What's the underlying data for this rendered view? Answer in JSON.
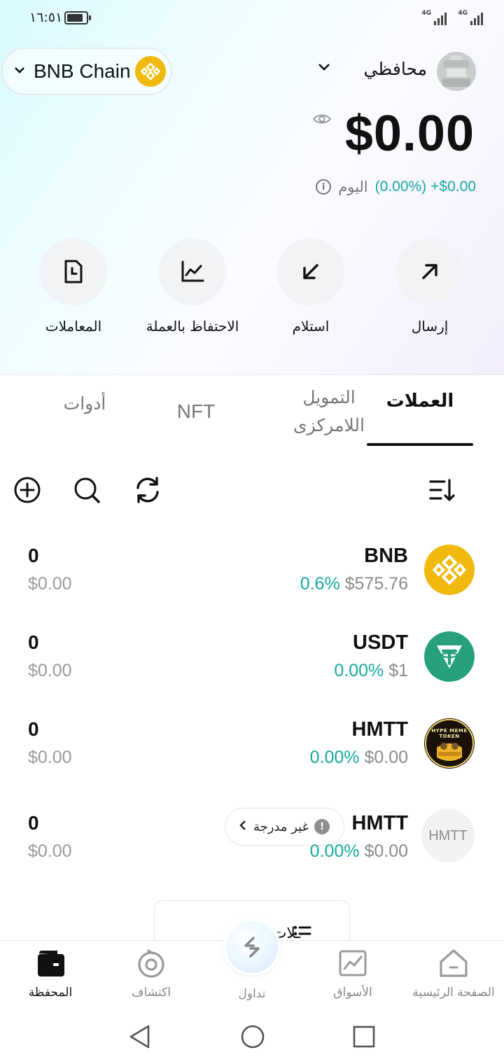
{
  "status_bar": {
    "time": "١٦:٥١",
    "network_1": "4G",
    "network_2": "4G"
  },
  "header": {
    "chain_name": "BNB Chain",
    "wallet_name": "محافظي"
  },
  "balance": {
    "total": "$0.00",
    "change_value": "+$0.00",
    "change_pct": "(0.00%)",
    "period": "اليوم"
  },
  "actions": [
    {
      "label": "إرسال",
      "icon": "arrow-up-right-icon"
    },
    {
      "label": "استلام",
      "icon": "arrow-down-left-icon"
    },
    {
      "label": "الاحتفاظ بالعملة",
      "icon": "chart-line-icon"
    },
    {
      "label": "المعاملات",
      "icon": "document-clock-icon"
    }
  ],
  "tabs": {
    "coins": "العملات",
    "defi_line1": "التمويل",
    "defi_line2": "اللامركزى",
    "nft": "NFT",
    "tools": "أدوات"
  },
  "tokens": [
    {
      "symbol": "BNB",
      "change": "0.6%",
      "price": "$575.76",
      "amount": "0",
      "fiat": "$0.00",
      "icon": "bnb-icon"
    },
    {
      "symbol": "USDT",
      "change": "0.00%",
      "price": "$1",
      "amount": "0",
      "fiat": "$0.00",
      "icon": "tether-icon"
    },
    {
      "symbol": "HMTT",
      "change": "0.00%",
      "price": "$0.00",
      "amount": "0",
      "fiat": "$0.00",
      "icon": "hype-meme-token-icon",
      "icon_text": "HYPE MEME TOKEN"
    },
    {
      "symbol": "HMTT",
      "change": "0.00%",
      "price": "$0.00",
      "amount": "0",
      "fiat": "$0.00",
      "icon": "hmtt-placeholder-icon",
      "icon_text": "HMTT",
      "badge": "غير مدرجة"
    }
  ],
  "manage": {
    "label": "ـلات"
  },
  "bottom_nav": [
    {
      "label": "الصفحة الرئيسية",
      "icon": "home-icon"
    },
    {
      "label": "الأسواق",
      "icon": "markets-icon"
    },
    {
      "label": "تداول",
      "icon": "trade-icon"
    },
    {
      "label": "اكتشاف",
      "icon": "discover-icon"
    },
    {
      "label": "المحفظة",
      "icon": "wallet-icon",
      "active": true
    }
  ],
  "colors": {
    "accent_positive": "#14a99f",
    "bnb_yellow": "#f0b90b",
    "tether_green": "#26a17b"
  }
}
